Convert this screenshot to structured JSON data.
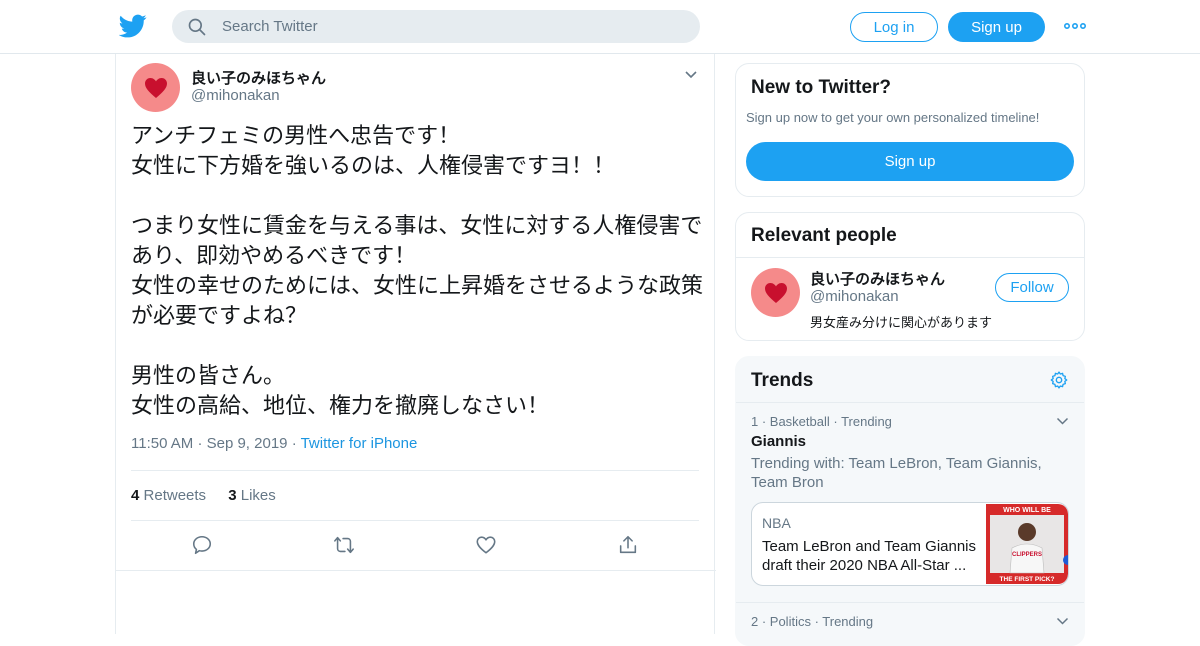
{
  "colors": {
    "brand": "#1da1f2",
    "link": "#1b95e0",
    "muted": "#657786",
    "text": "#14171a",
    "avatar_bg": "#f58a8a"
  },
  "header": {
    "logo_icon": "twitter-bird-icon",
    "search_placeholder": "Search Twitter",
    "login_label": "Log in",
    "signup_label": "Sign up",
    "more_icon": "more-dots-icon"
  },
  "tweet": {
    "name": "良い子のみほちゃん",
    "handle": "@mihonakan",
    "text": "アンチフェミの男性へ忠告です！\n女性に下方婚を強いるのは、人権侵害ですヨ！！\n\nつまり女性に賃金を与える事は、女性に対する人権侵害であり、即効やめるべきです！\n女性の幸せのためには、女性に上昇婚をさせるような政策が必要ですよね？\n\n男性の皆さん。\n女性の高給、地位、権力を撤廃しなさい！",
    "time": "11:50 AM",
    "date": "Sep 9, 2019",
    "source": "Twitter for iPhone",
    "retweets_count": "4",
    "retweets_label": "Retweets",
    "likes_count": "3",
    "likes_label": "Likes"
  },
  "sidebar": {
    "signup_card": {
      "title": "New to Twitter?",
      "subtitle": "Sign up now to get your own personalized timeline!",
      "button": "Sign up"
    },
    "relevant": {
      "title": "Relevant people",
      "name": "良い子のみほちゃん",
      "handle": "@mihonakan",
      "bio": "男女産み分けに関心があります",
      "follow": "Follow"
    },
    "trends": {
      "title": "Trends",
      "items": [
        {
          "meta": "1 · Basketball · Trending",
          "name": "Giannis",
          "with": "Trending with: Team LeBron, Team Giannis, Team Bron",
          "news_category": "NBA",
          "news_headline": "Team LeBron and Team Giannis draft their 2020 NBA All-Star ...",
          "news_thumb_top": "WHO WILL BE",
          "news_thumb_bottom": "THE FIRST PICK?",
          "news_thumb_jersey": "CLIPPERS"
        },
        {
          "meta": "2 · Politics · Trending"
        }
      ]
    }
  }
}
